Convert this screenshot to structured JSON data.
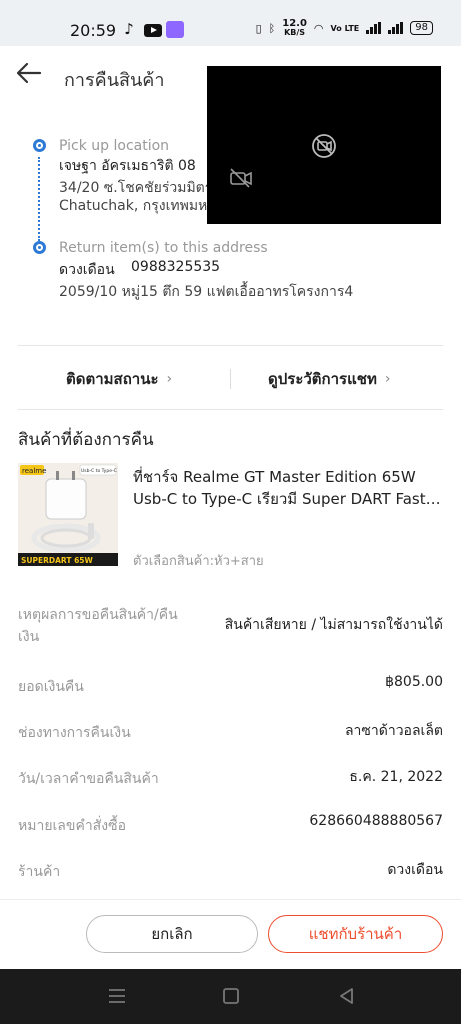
{
  "status_bar": {
    "time": "20:59",
    "network_speed": "12.0",
    "network_unit": "KB/S",
    "volte": "Vo LTE",
    "battery": "98"
  },
  "header": {
    "title": "การคืนสินค้า",
    "back_icon": "arrow-left-icon"
  },
  "video_overlay": {
    "icons": [
      "video-off-icon",
      "camera-off-icon"
    ]
  },
  "pickup": {
    "label": "Pick up location",
    "name_phone": "เจษฐา อัครเมธาริติ   08",
    "address_line1": "34/20 ซ.โชคชัยร่วมมิตร",
    "address_line2": "Chatuchak, กรุงเทพมหา"
  },
  "return_to": {
    "label": "Return item(s) to this address",
    "name": "ดวงเดือน",
    "phone": "0988325535",
    "address": "2059/10 หมู่15 ตึก 59 แฟตเอื้ออาทรโครงการ4"
  },
  "actions": {
    "track_status": "ติดตามสถานะ",
    "chat_history": "ดูประวัติการแชท"
  },
  "product_section": {
    "title": "สินค้าที่ต้องการคืน",
    "product_name": "ที่ชาร์จ Realme GT Master Edition 65W Usb-C to Type-C เรียวมี Super DART Fast…",
    "variant": "ตัวเลือกสินค้า:หัว+สาย",
    "image_brand": "realme",
    "image_caption": "SUPERDART 65W",
    "image_tag": "Usb-C to Type-C"
  },
  "details": [
    {
      "label": "เหตุผลการขอคืนสินค้า/คืนเงิน",
      "value": "สินค้าเสียหาย / ไม่สามารถใช้งานได้"
    },
    {
      "label": "ยอดเงินคืน",
      "value": "฿805.00"
    },
    {
      "label": "ช่องทางการคืนเงิน",
      "value": "ลาซาด้าวอลเล็ต"
    },
    {
      "label": "วัน/เวลาคำขอคืนสินค้า",
      "value": "ธ.ค. 21, 2022"
    },
    {
      "label": "หมายเลขคำสั่งซื้อ",
      "value": "628660488880567"
    },
    {
      "label": "ร้านค้า",
      "value": "ดวงเดือน"
    }
  ],
  "buttons": {
    "cancel": "ยกเลิก",
    "chat_seller": "แชทกับร้านค้า"
  },
  "colors": {
    "accent": "#ee4d2d",
    "route_blue": "#2d7ad6"
  }
}
